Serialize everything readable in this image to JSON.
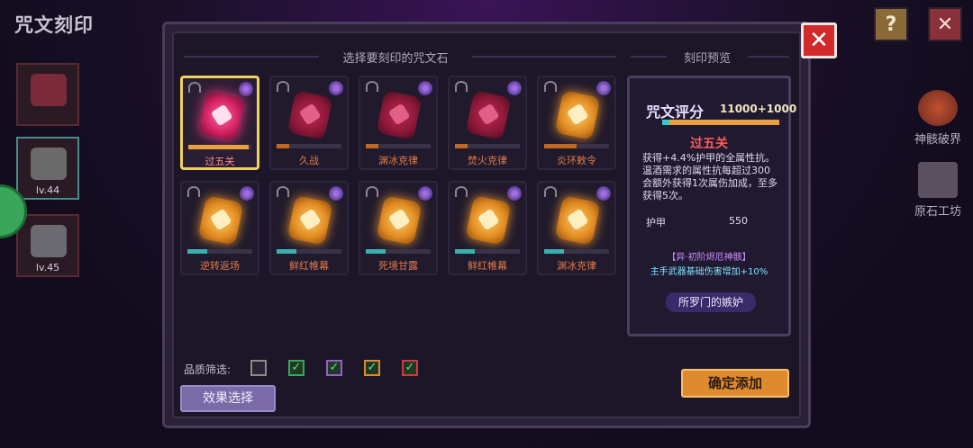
{
  "page_title": "咒文刻印",
  "top_buttons": {
    "help": "?",
    "close": "✕"
  },
  "side_slots": [
    {
      "level": ""
    },
    {
      "level": "lv.44"
    },
    {
      "level": "lv.45"
    }
  ],
  "right_features": [
    "神骸破界",
    "原石工坊"
  ],
  "panel": {
    "close": "✕",
    "select_header": "选择要刻印的咒文石",
    "preview_header": "刻印预览"
  },
  "runestones": [
    {
      "name": "过五关",
      "color": "pink",
      "progress": 0.95,
      "bar_color": "#e8a040",
      "selected": true
    },
    {
      "name": "久战",
      "color": "red",
      "progress": 0.2,
      "bar_color": "#c06a20",
      "selected": false
    },
    {
      "name": "渊冰克律",
      "color": "red",
      "progress": 0.2,
      "bar_color": "#c06a20",
      "selected": false
    },
    {
      "name": "焚火克律",
      "color": "red",
      "progress": 0.2,
      "bar_color": "#c06a20",
      "selected": false
    },
    {
      "name": "炎环敕令",
      "color": "gold",
      "progress": 0.5,
      "bar_color": "#c06a20",
      "selected": false
    },
    {
      "name": "逆转返场",
      "color": "gold",
      "progress": 0.3,
      "bar_color": "#3ab0b0",
      "selected": false
    },
    {
      "name": "鲜红帷幕",
      "color": "gold",
      "progress": 0.3,
      "bar_color": "#3ab0b0",
      "selected": false
    },
    {
      "name": "死境甘露",
      "color": "gold",
      "progress": 0.3,
      "bar_color": "#3ab0b0",
      "selected": false
    },
    {
      "name": "鲜红帷幕",
      "color": "gold",
      "progress": 0.3,
      "bar_color": "#3ab0b0",
      "selected": false
    },
    {
      "name": "渊冰克律",
      "color": "gold",
      "progress": 0.3,
      "bar_color": "#3ab0b0",
      "selected": false
    }
  ],
  "preview": {
    "title": "咒文评分",
    "score": "11000+1000",
    "score_progress": 0.06,
    "rune_name": "过五关",
    "desc": "获得+4.4%护甲的全属性抗。温酒需求的属性抗每超过300会额外获得1次属伤加成，至多获得5次。",
    "stat_label": "护甲",
    "stat_value": "550",
    "set_name": "【异·初阶烬厄神骸】",
    "set_effect": "主手武器基础伤害增加+10%",
    "bottom_label": "所罗门的嫉妒"
  },
  "filter": {
    "label": "品质筛选:",
    "boxes": [
      {
        "color": "#8a8a8a",
        "checked": false
      },
      {
        "color": "#3aa65a",
        "checked": true
      },
      {
        "color": "#9a5ad0",
        "checked": true
      },
      {
        "color": "#e08a30",
        "checked": true
      },
      {
        "color": "#d03a3a",
        "checked": true
      }
    ]
  },
  "buttons": {
    "effect_select": "效果选择",
    "confirm_add": "确定添加"
  }
}
